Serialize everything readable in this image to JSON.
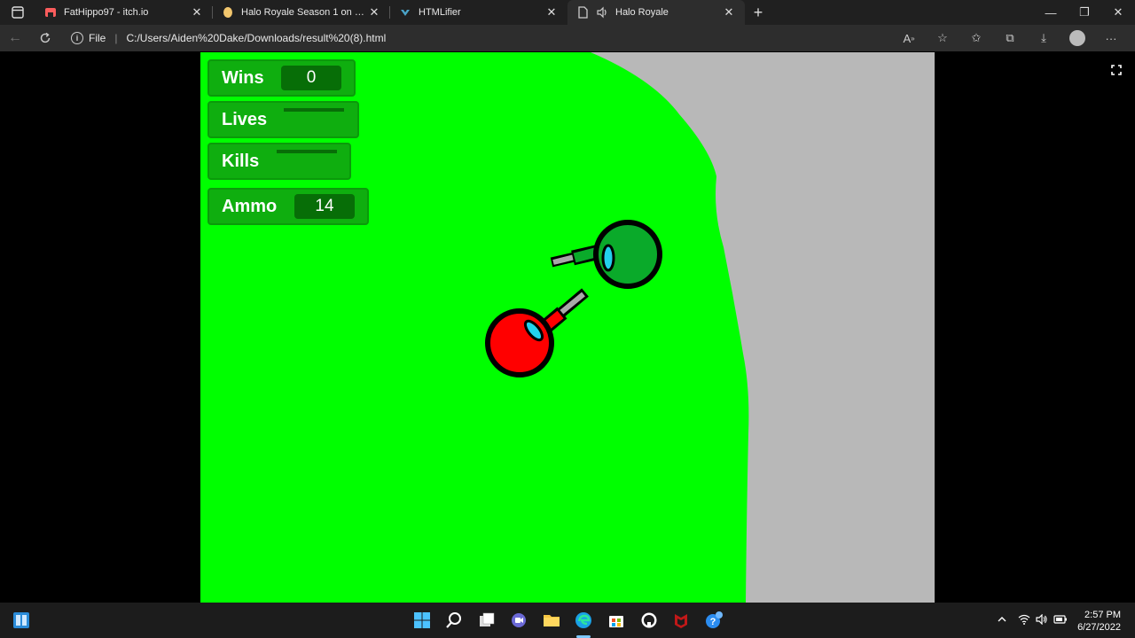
{
  "browser": {
    "tabs": [
      {
        "title": "FatHippo97 - itch.io",
        "favicon": "itch-icon",
        "color": "#fa5c5c",
        "active": false
      },
      {
        "title": "Halo Royale Season 1 on Scratch",
        "favicon": "scratch-icon",
        "color": "#f2c66d",
        "active": false
      },
      {
        "title": "HTMLifier",
        "favicon": "htmlifier-icon",
        "color": "#4aa3c8",
        "active": false
      },
      {
        "title": "Halo Royale",
        "favicon": "page-icon",
        "color": "#cccccc",
        "active": true
      }
    ],
    "url_scheme_label": "File",
    "url": "C:/Users/Aiden%20Dake/Downloads/result%20(8).html"
  },
  "game": {
    "monitors": {
      "wins": {
        "label": "Wins",
        "value": "0"
      },
      "lives": {
        "label": "Lives",
        "value": ""
      },
      "kills": {
        "label": "Kills",
        "value": ""
      },
      "ammo": {
        "label": "Ammo",
        "value": "14"
      }
    },
    "colors": {
      "grass": "#00ff00",
      "boundary": "#b8b8b8",
      "player_red": "#ff0000",
      "player_green": "#0aaa2a",
      "visor": "#22d0ee"
    }
  },
  "taskbar": {
    "time": "2:57 PM",
    "date": "6/27/2022"
  }
}
